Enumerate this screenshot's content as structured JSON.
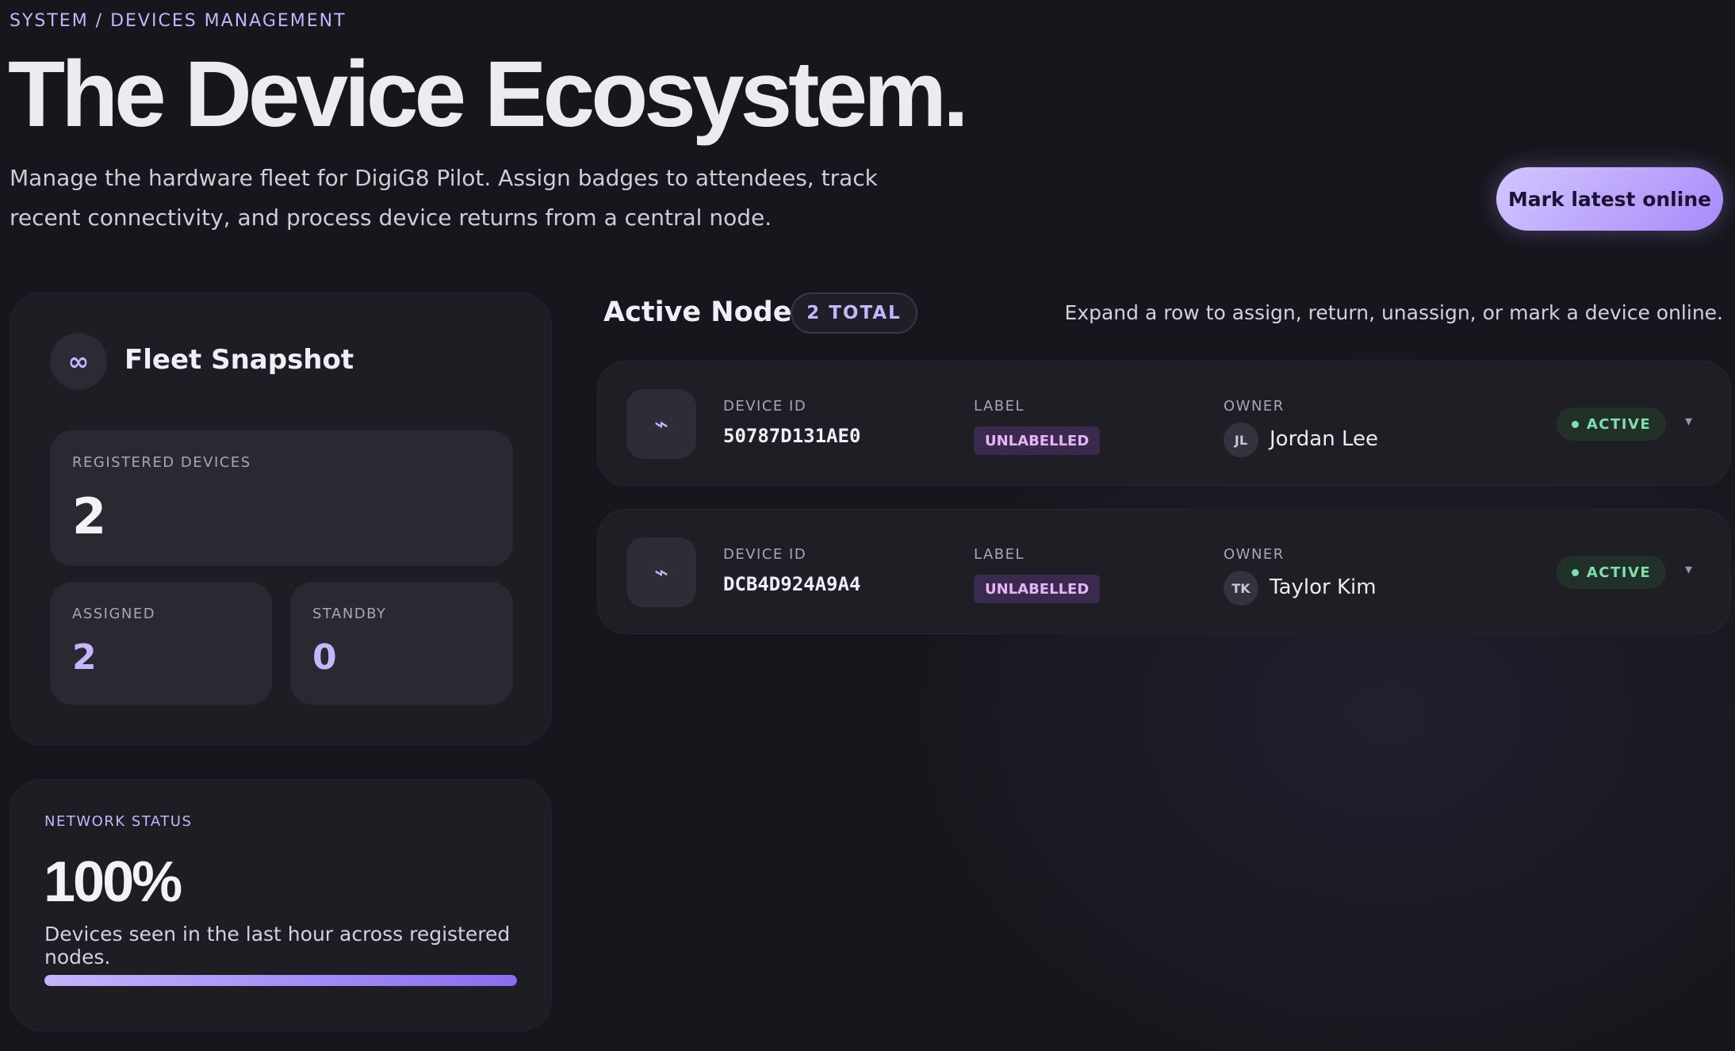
{
  "header": {
    "breadcrumb": "SYSTEM / DEVICES MANAGEMENT",
    "title": "The Device Ecosystem.",
    "subtitle": "Manage the hardware fleet for DigiG8 Pilot. Assign badges to attendees, track recent connectivity, and process device returns from a central node.",
    "primary_button": "Mark latest online"
  },
  "snapshot": {
    "icon": "infinity-icon",
    "icon_glyph": "∞",
    "title": "Fleet Snapshot",
    "registered_label": "REGISTERED DEVICES",
    "registered_value": "2",
    "assigned_label": "ASSIGNED",
    "assigned_value": "2",
    "standby_label": "STANDBY",
    "standby_value": "0"
  },
  "network": {
    "label": "NETWORK STATUS",
    "value": "100%",
    "description": "Devices seen in the last hour across registered nodes.",
    "progress_percent": 100
  },
  "nodes": {
    "title": "Active Nodes",
    "total_badge": "2 TOTAL",
    "hint": "Expand a row to assign, return, unassign, or mark a device online.",
    "columns": {
      "device": "DEVICE ID",
      "label": "LABEL",
      "owner": "OWNER"
    },
    "rows": [
      {
        "icon": "bolt-icon",
        "icon_glyph": "⌁",
        "device_id": "50787D131AE0",
        "label": "UNLABELLED",
        "owner_initials": "JL",
        "owner_name": "Jordan Lee",
        "status": "ACTIVE",
        "chevron": "▾"
      },
      {
        "icon": "bolt-icon",
        "icon_glyph": "⌁",
        "device_id": "DCB4D924A9A4",
        "label": "UNLABELLED",
        "owner_initials": "TK",
        "owner_name": "Taylor Kim",
        "status": "ACTIVE",
        "chevron": "▾"
      }
    ]
  },
  "colors": {
    "background": "#17161c",
    "card": "#1e1d24",
    "accent": "#c4b5fd",
    "accent_strong": "#a78bfa",
    "status_active": "#7ee0ab",
    "label_chip": "#e7b4f7"
  }
}
